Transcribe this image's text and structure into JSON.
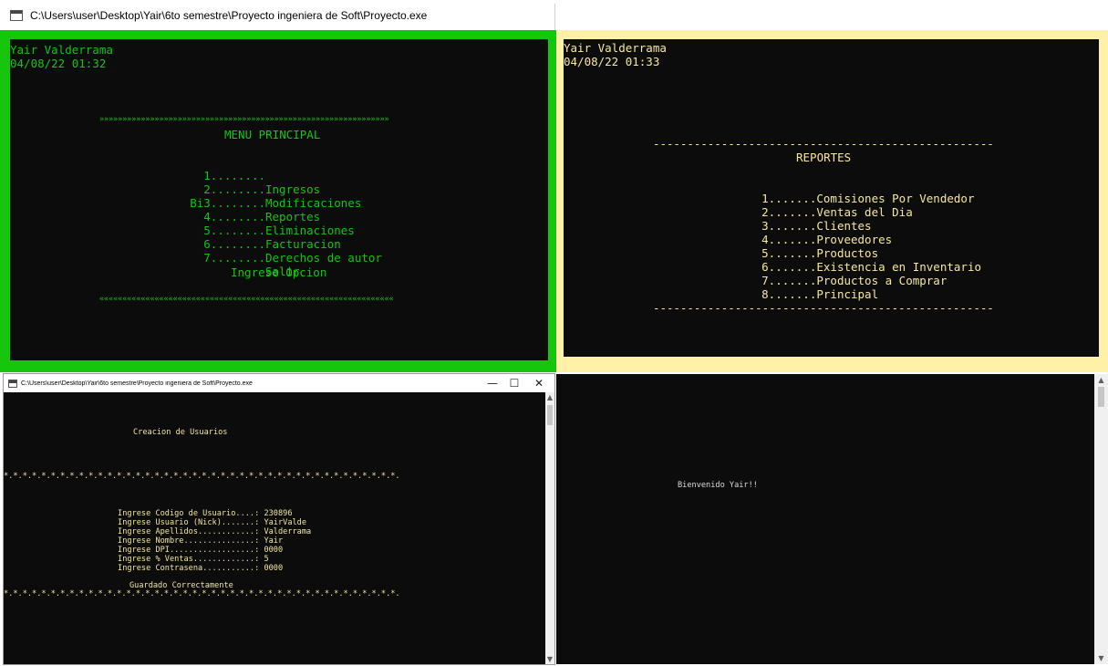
{
  "main_window": {
    "title": "C:\\Users\\user\\Desktop\\Yair\\6to semestre\\Proyecto ingeniera de Soft\\Proyecto.exe"
  },
  "menu_principal": {
    "user": "Yair Valderrama",
    "datetime": "04/08/22 01:32",
    "border_top": "»»»»»»»»»»»»»»»»»»»»»»»»»»»»»»»»»»»»»»»»»»»»»»»»»»»»»»»»»»»»»»»",
    "title": "MENU PRINCIPAL",
    "items": [
      {
        "num": "1........",
        "label": "Ingresos"
      },
      {
        "num": "2........",
        "label": "Modificaciones"
      },
      {
        "num": "Bi3........",
        "label": "Reportes"
      },
      {
        "num": "4........",
        "label": "Eliminaciones"
      },
      {
        "num": "5........",
        "label": "Facturacion"
      },
      {
        "num": "6........",
        "label": "Derechos de autor"
      },
      {
        "num": "7........",
        "label": "Salir"
      }
    ],
    "prompt": "Ingrese Opcion",
    "border_bottom": "««««««««««««««««««««««««««««««««««««««««««««««««««««««««««««««««"
  },
  "reportes": {
    "user": "Yair Valderrama",
    "datetime": "04/08/22 01:33",
    "rule": "--------------------------------------------------",
    "title": "REPORTES",
    "items": [
      {
        "num": "1.......",
        "label": "Comisiones Por Vendedor"
      },
      {
        "num": "2.......",
        "label": "Ventas del Dia"
      },
      {
        "num": "3.......",
        "label": "Clientes"
      },
      {
        "num": "4.......",
        "label": "Proveedores"
      },
      {
        "num": "5.......",
        "label": "Productos"
      },
      {
        "num": "6.......",
        "label": "Existencia en Inventario"
      },
      {
        "num": "7.......",
        "label": "Productos a Comprar"
      },
      {
        "num": "8.......",
        "label": "Principal"
      }
    ]
  },
  "creacion_window": {
    "title": "C:\\Users\\user\\Desktop\\Yair\\6to semestre\\Proyecto ingeniera de Soft\\Proyecto.exe",
    "minimize": "—",
    "maximize": "☐",
    "close": "✕",
    "heading": "Creacion de Usuarios",
    "stars": "*.*.*.*.*.*.*.*.*.*.*.*.*.*.*.*.*.*.*.*.*.*.*.*.*.*.*.*.*.*.*.*.*.*.*.*.*.*.*.*.*.*.",
    "fields": [
      {
        "label": "Ingrese Codigo de Usuario....:",
        "value": "230896"
      },
      {
        "label": "Ingrese Usuario (Nick).......:",
        "value": "YairValde"
      },
      {
        "label": "Ingrese Apellidos............:",
        "value": "Valderrama"
      },
      {
        "label": "Ingrese Nombre...............:",
        "value": "Yair"
      },
      {
        "label": "Ingrese DPI..................:",
        "value": "0000"
      },
      {
        "label": "Ingrese % Ventas.............:",
        "value": "5"
      },
      {
        "label": "Ingrese Contrasena...........:",
        "value": "0000"
      }
    ],
    "saved": "Guardado Correctamente"
  },
  "bienvenido": {
    "message": "Bienvenido Yair!!"
  },
  "colors": {
    "green_border": "#16c60c",
    "cream_border": "#fff1a8",
    "console_bg": "#0c0c0c",
    "green_text": "#13c413",
    "yellow_text": "#f9e79f"
  }
}
